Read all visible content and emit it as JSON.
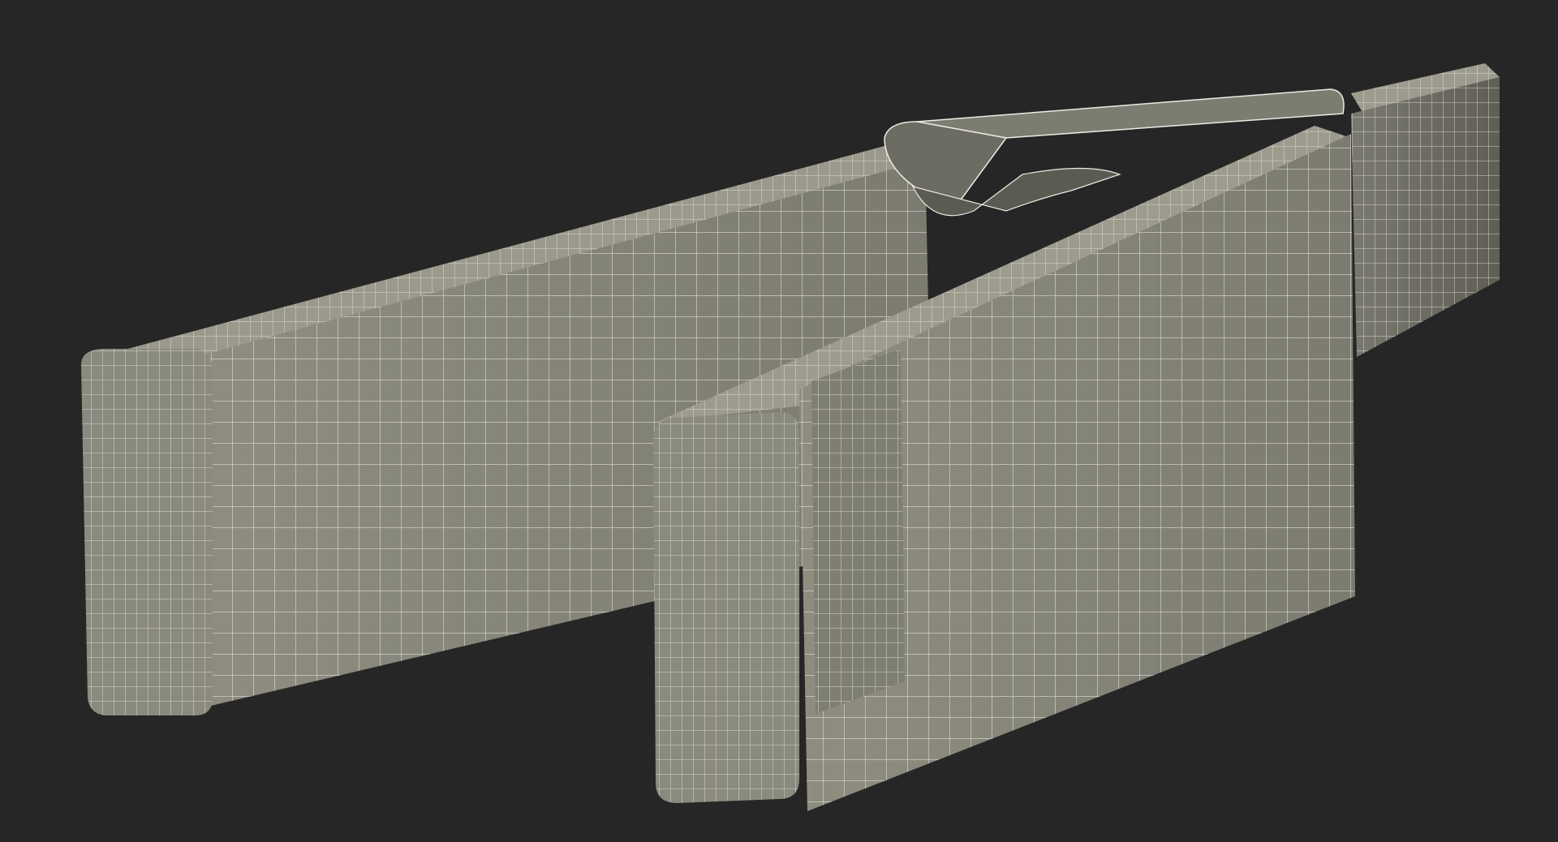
{
  "scene": {
    "subject": "clothespin-wireframe",
    "colors": {
      "background": "#262626",
      "surface_light": "#8e8d80",
      "surface_mid": "#76756a",
      "surface_dark": "#5f5e55",
      "wire": "#ecebe4"
    },
    "parts": [
      "left-arm",
      "right-arm",
      "spring",
      "hinge-block"
    ]
  }
}
